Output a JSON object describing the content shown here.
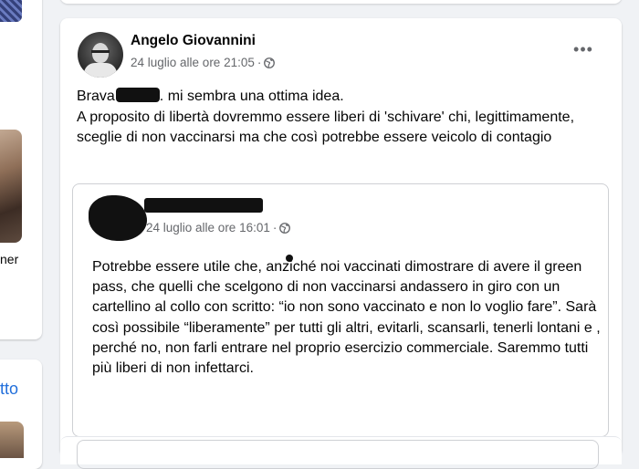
{
  "left_column": {
    "partial_text": "ner",
    "partial_link": "tto"
  },
  "post": {
    "author": "Angelo Giovannini",
    "timestamp": "24 luglio alle ore 21:05",
    "separator": "·",
    "more_label": "•••",
    "text_line1_start": "Brava",
    "text_line1_end": ". mi sembra una ottima idea.",
    "text_rest": "A proposito di libertà dovremmo essere liberi di 'schivare' chi, legittimamente, sceglie di non vaccinarsi ma che così potrebbe essere veicolo di contagio"
  },
  "shared_post": {
    "timestamp": "24 luglio alle ore 16:01",
    "separator": "·",
    "text": "Potrebbe essere utile che, anziché noi vaccinati dimostrare di avere il green pass, che quelli che scelgono di non vaccinarsi andassero in giro con un cartellino al collo con scritto: “io non sono vaccinato e non lo voglio fare”. Sarà così possibile “liberamente” per tutti gli altri, evitarli, scansarli, tenerli lontani e , perché no, non farli entrare nel proprio esercizio commerciale. Saremmo tutti più liberi di non infettarci."
  },
  "icons": {
    "privacy": "globe-icon",
    "menu": "more-options-icon"
  },
  "colors": {
    "background": "#f0f2f5",
    "card": "#ffffff",
    "secondary_text": "#65676b",
    "link": "#216fdb"
  }
}
